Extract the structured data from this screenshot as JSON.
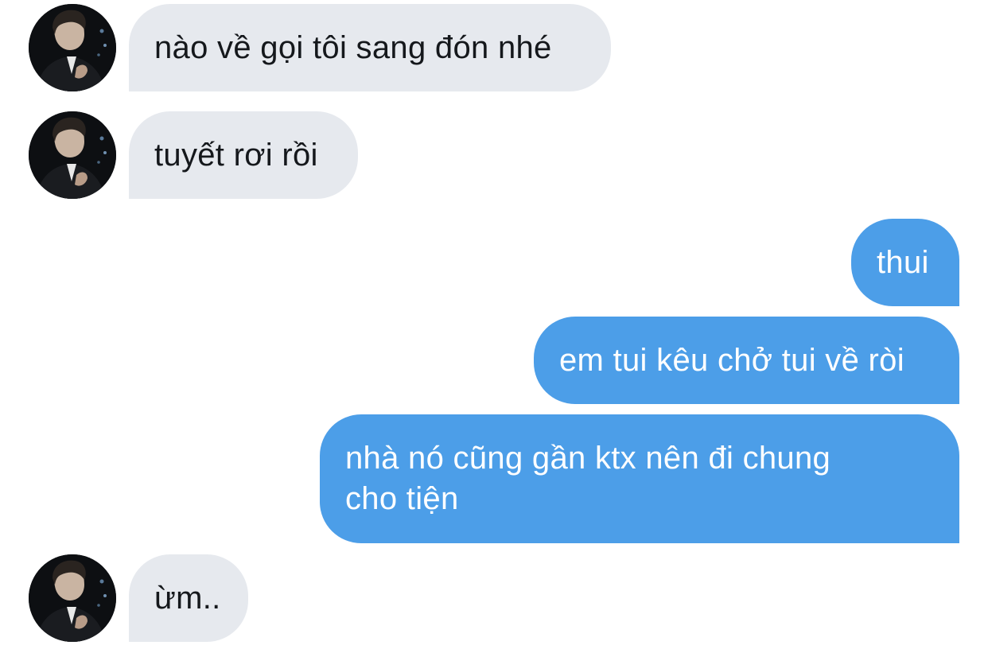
{
  "conversation": {
    "messages": [
      {
        "direction": "incoming",
        "text": "nào về gọi tôi sang đón nhé"
      },
      {
        "direction": "incoming",
        "text": "tuyết rơi rồi"
      },
      {
        "direction": "outgoing",
        "text": "thui"
      },
      {
        "direction": "outgoing",
        "text": "em tui kêu chở tui về ròi"
      },
      {
        "direction": "outgoing",
        "text": "nhà nó cũng gần ktx nên đi chung cho tiện"
      },
      {
        "direction": "incoming",
        "text": "ừm.."
      }
    ]
  },
  "colors": {
    "incoming_bubble": "#e6e9ee",
    "incoming_text": "#15181c",
    "outgoing_bubble": "#4c9ee8",
    "outgoing_text": "#ffffff",
    "background": "#ffffff"
  },
  "avatar": {
    "icon": "profile-avatar-icon"
  }
}
